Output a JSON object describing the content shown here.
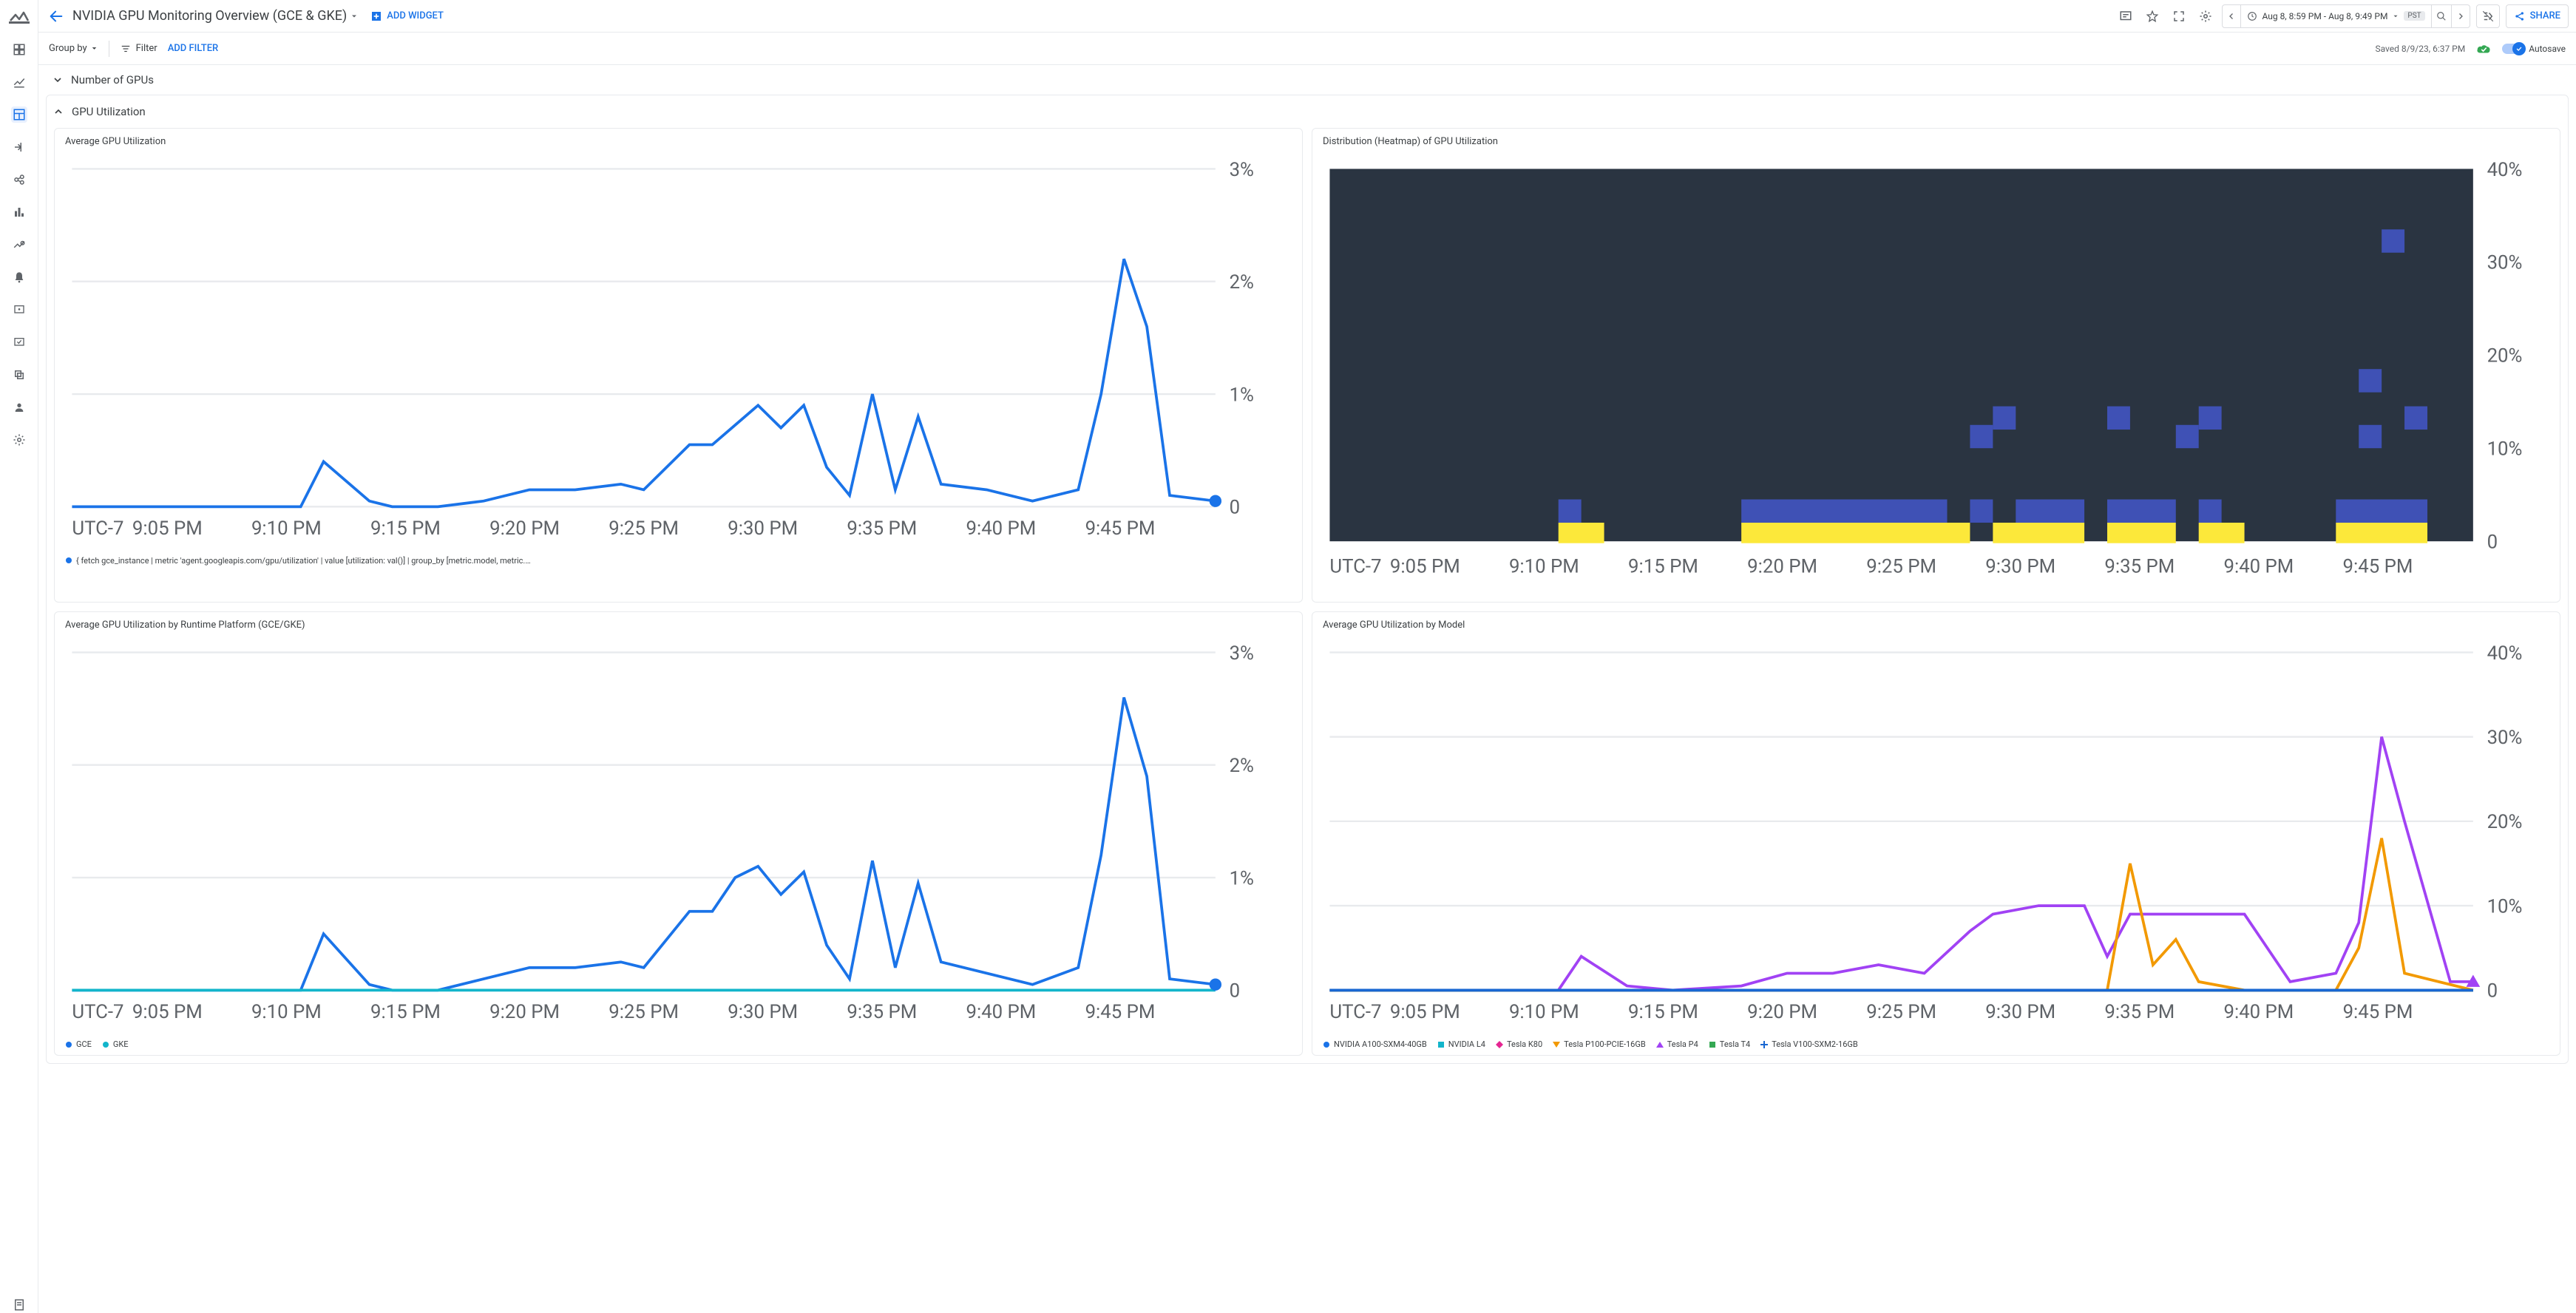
{
  "header": {
    "title": "NVIDIA GPU Monitoring Overview (GCE & GKE)",
    "add_widget": "ADD WIDGET",
    "time_range": "Aug 8, 8:59 PM - Aug 8, 9:49 PM",
    "timezone": "PST",
    "share": "SHARE"
  },
  "filterbar": {
    "group_by": "Group by",
    "filter": "Filter",
    "add_filter": "ADD FILTER",
    "saved": "Saved 8/9/23, 6:37 PM",
    "autosave": "Autosave"
  },
  "sections": {
    "gpus": "Number of GPUs",
    "util": "GPU Utilization"
  },
  "cards": {
    "avg": {
      "title": "Average GPU Utilization",
      "legend": "{ fetch gce_instance | metric 'agent.googleapis.com/gpu/utilization' | value [utilization: val()] | group_by [metric.model, metric.uuid] | ma..."
    },
    "heatmap": {
      "title": "Distribution (Heatmap) of GPU Utilization"
    },
    "platform": {
      "title": "Average GPU Utilization by Runtime Platform (GCE/GKE)",
      "legend": [
        "GCE",
        "GKE"
      ]
    },
    "model": {
      "title": "Average GPU Utilization by Model",
      "legend": [
        "NVIDIA A100-SXM4-40GB",
        "NVIDIA L4",
        "Tesla K80",
        "Tesla P100-PCIE-16GB",
        "Tesla P4",
        "Tesla T4",
        "Tesla V100-SXM2-16GB"
      ]
    }
  },
  "axis": {
    "x_tz": "UTC-7",
    "x_labels": [
      "9:05 PM",
      "9:10 PM",
      "9:15 PM",
      "9:20 PM",
      "9:25 PM",
      "9:30 PM",
      "9:35 PM",
      "9:40 PM",
      "9:45 PM"
    ],
    "y_pct3": [
      "0",
      "1%",
      "2%",
      "3%"
    ],
    "y_pct40": [
      "0",
      "10%",
      "20%",
      "30%",
      "40%"
    ]
  },
  "chart_data": [
    {
      "type": "line",
      "name": "Average GPU Utilization",
      "x_range_minutes": [
        0,
        50
      ],
      "ylim": [
        0,
        3
      ],
      "x": [
        0,
        2,
        4,
        6,
        8,
        10,
        11,
        13,
        14,
        16,
        18,
        20,
        22,
        24,
        25,
        27,
        28,
        30,
        31,
        32,
        33,
        34,
        35,
        36,
        37,
        38,
        40,
        42,
        44,
        45,
        46,
        47,
        48,
        50
      ],
      "y": [
        0,
        0,
        0,
        0,
        0,
        0,
        0.4,
        0.05,
        0,
        0,
        0.05,
        0.15,
        0.15,
        0.2,
        0.15,
        0.55,
        0.55,
        0.9,
        0.7,
        0.9,
        0.35,
        0.1,
        1.0,
        0.15,
        0.8,
        0.2,
        0.15,
        0.05,
        0.15,
        1.0,
        2.2,
        1.6,
        0.1,
        0.05
      ]
    },
    {
      "type": "heatmap",
      "name": "Distribution (Heatmap) of GPU Utilization",
      "x_range_minutes": [
        0,
        50
      ],
      "ylim": [
        0,
        40
      ],
      "blue_cells": [
        {
          "t": 10,
          "y": 2
        },
        {
          "t": 18,
          "y": 2,
          "w": 9
        },
        {
          "t": 28,
          "y": 2
        },
        {
          "t": 30,
          "y": 2,
          "w": 3
        },
        {
          "t": 34,
          "y": 2,
          "w": 3
        },
        {
          "t": 38,
          "y": 2
        },
        {
          "t": 44,
          "y": 2,
          "w": 4
        },
        {
          "t": 28,
          "y": 10
        },
        {
          "t": 29,
          "y": 12
        },
        {
          "t": 34,
          "y": 12
        },
        {
          "t": 37,
          "y": 10
        },
        {
          "t": 38,
          "y": 12
        },
        {
          "t": 45,
          "y": 10
        },
        {
          "t": 45,
          "y": 16
        },
        {
          "t": 46,
          "y": 31
        },
        {
          "t": 47,
          "y": 12
        }
      ],
      "yellow_cells": [
        {
          "t": 10,
          "y": 0,
          "w": 2
        },
        {
          "t": 18,
          "y": 0,
          "w": 10
        },
        {
          "t": 29,
          "y": 0,
          "w": 4
        },
        {
          "t": 34,
          "y": 0,
          "w": 3
        },
        {
          "t": 38,
          "y": 0,
          "w": 2
        },
        {
          "t": 44,
          "y": 0,
          "w": 4
        }
      ]
    },
    {
      "type": "line",
      "name": "Average GPU Utilization by Runtime Platform (GCE/GKE)",
      "x_range_minutes": [
        0,
        50
      ],
      "ylim": [
        0,
        3
      ],
      "series": [
        {
          "name": "GCE",
          "color": "#1a73e8",
          "x": [
            0,
            2,
            4,
            6,
            8,
            10,
            11,
            13,
            14,
            16,
            18,
            20,
            22,
            24,
            25,
            27,
            28,
            29,
            30,
            31,
            32,
            33,
            34,
            35,
            36,
            37,
            38,
            40,
            42,
            44,
            45,
            46,
            47,
            48,
            50
          ],
          "y": [
            0,
            0,
            0,
            0,
            0,
            0,
            0.5,
            0.05,
            0,
            0,
            0.1,
            0.2,
            0.2,
            0.25,
            0.2,
            0.7,
            0.7,
            1.0,
            1.1,
            0.85,
            1.05,
            0.4,
            0.1,
            1.15,
            0.2,
            0.95,
            0.25,
            0.15,
            0.05,
            0.2,
            1.2,
            2.6,
            1.9,
            0.1,
            0.05
          ]
        },
        {
          "name": "GKE",
          "color": "#12b5cb",
          "x": [
            0,
            50
          ],
          "y": [
            0,
            0
          ]
        }
      ]
    },
    {
      "type": "line",
      "name": "Average GPU Utilization by Model",
      "x_range_minutes": [
        0,
        50
      ],
      "ylim": [
        0,
        40
      ],
      "series": [
        {
          "name": "Tesla P4",
          "color": "#a142f4",
          "x": [
            0,
            4,
            8,
            10,
            11,
            13,
            15,
            18,
            20,
            22,
            24,
            26,
            28,
            29,
            31,
            33,
            34,
            35,
            38,
            40,
            42,
            44,
            45,
            46,
            47,
            49,
            50
          ],
          "y": [
            0,
            0,
            0,
            0,
            4,
            0.5,
            0,
            0.5,
            2,
            2,
            3,
            2,
            7,
            9,
            10,
            10,
            4,
            9,
            9,
            9,
            1,
            2,
            8,
            30,
            20,
            1,
            1
          ]
        },
        {
          "name": "Tesla P100-PCIE-16GB",
          "color": "#f29900",
          "x": [
            0,
            20,
            28,
            34,
            35,
            36,
            37,
            38,
            40,
            44,
            45,
            46,
            47,
            50
          ],
          "y": [
            0,
            0,
            0,
            0,
            15,
            3,
            6,
            1,
            0,
            0,
            5,
            18,
            2,
            0
          ]
        },
        {
          "name": "NVIDIA A100-SXM4-40GB",
          "color": "#1a73e8",
          "x": [
            0,
            50
          ],
          "y": [
            0,
            0
          ]
        },
        {
          "name": "NVIDIA L4",
          "color": "#12b5cb",
          "x": [
            0,
            50
          ],
          "y": [
            0,
            0
          ]
        },
        {
          "name": "Tesla K80",
          "color": "#e52592",
          "x": [
            0,
            50
          ],
          "y": [
            0,
            0
          ]
        },
        {
          "name": "Tesla T4",
          "color": "#34a853",
          "x": [
            0,
            50
          ],
          "y": [
            0,
            0
          ]
        },
        {
          "name": "Tesla V100-SXM2-16GB",
          "color": "#1967d2",
          "x": [
            0,
            50
          ],
          "y": [
            0,
            0
          ]
        }
      ]
    }
  ]
}
